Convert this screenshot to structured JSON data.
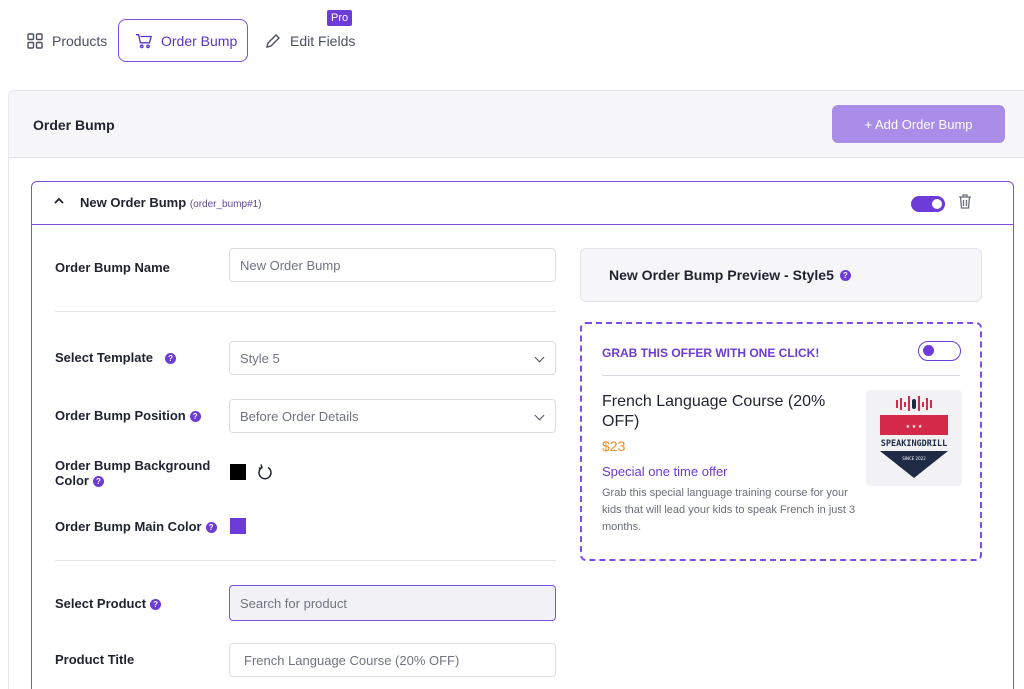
{
  "tabs": {
    "products": "Products",
    "order_bump": "Order Bump",
    "edit_fields": "Edit Fields",
    "pro_badge": "Pro"
  },
  "card": {
    "title": "Order Bump",
    "add_button": "+ Add Order Bump"
  },
  "bump": {
    "title": "New Order Bump",
    "id": "(order_bump#1)",
    "enabled": true
  },
  "form": {
    "name_label": "Order Bump Name",
    "name_value": "New Order Bump",
    "template_label": "Select Template",
    "template_value": "Style 5",
    "position_label": "Order Bump Position",
    "position_value": "Before Order Details",
    "bg_color_label": "Order Bump Background Color",
    "bg_color": "#000000",
    "main_color_label": "Order Bump Main Color",
    "main_color": "#6c3bd8",
    "product_label": "Select Product",
    "product_placeholder": "Search for product",
    "title_label": "Product Title",
    "title_value": "French Language Course (20% OFF)"
  },
  "preview": {
    "heading": "New Order Bump Preview - Style5",
    "grab": "GRAB THIS OFFER WITH ONE CLICK!",
    "product_name": "French Language Course (20% OFF)",
    "price": "$23",
    "special": "Special one time offer",
    "description": "Grab this special language training course for your kids that will lead your kids to speak French in just 3 months.",
    "logo_text": "SPEAKINGDRILL",
    "logo_since": "SINCE 2022"
  },
  "colors": {
    "accent": "#6c3bd8",
    "accent_light": "#a98de9",
    "price": "#f08a24"
  }
}
